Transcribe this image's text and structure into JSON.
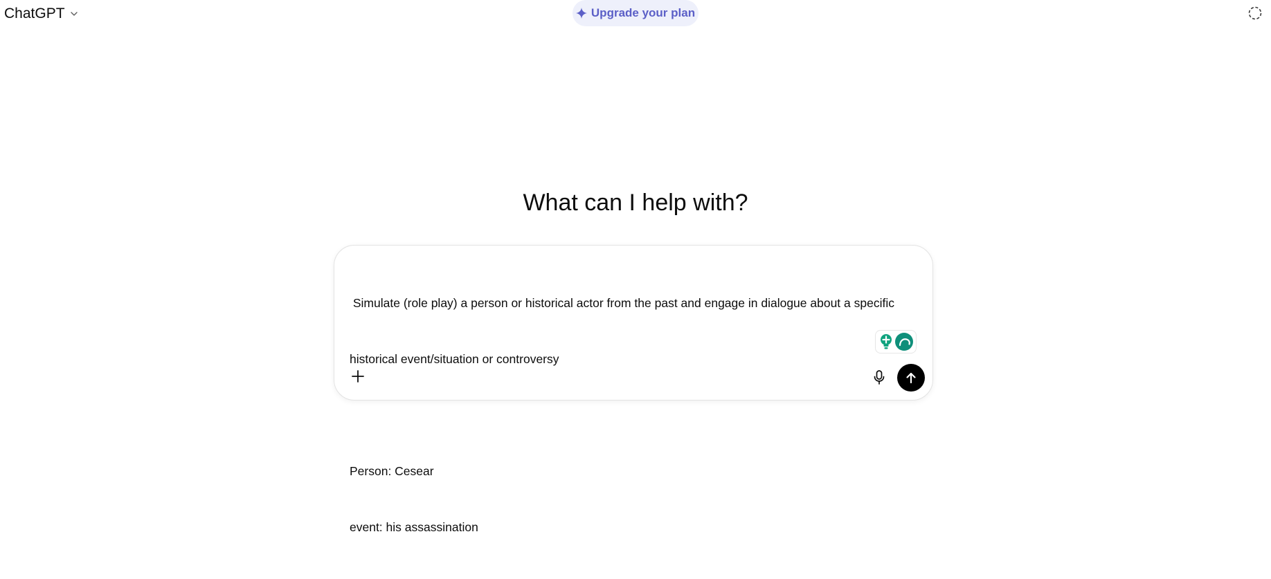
{
  "header": {
    "model_name": "ChatGPT",
    "upgrade_label": "Upgrade your plan"
  },
  "main": {
    "heading": "What can I help with?"
  },
  "composer": {
    "lines": [
      " Simulate (role play) a person or historical actor from the past and engage in dialogue about a specific",
      "historical event/situation or controversy",
      "",
      "Person: Cesear",
      "event: his assassination"
    ]
  },
  "icons": {
    "model_chevron": "chevron-down-icon",
    "upgrade": "sparkle-icon",
    "temporary_chat": "dashed-circle-icon",
    "attach": "plus-icon",
    "extension_1": "lightbulb-icon",
    "extension_2": "chat-bubble-icon",
    "voice": "microphone-icon",
    "send": "arrow-up-icon"
  },
  "colors": {
    "accent": "#5b5fc7",
    "upgrade_bg": "#eef0fb",
    "extension_green": "#10a37f",
    "extension_teal": "#0f8f7a",
    "send_bg": "#000000"
  }
}
